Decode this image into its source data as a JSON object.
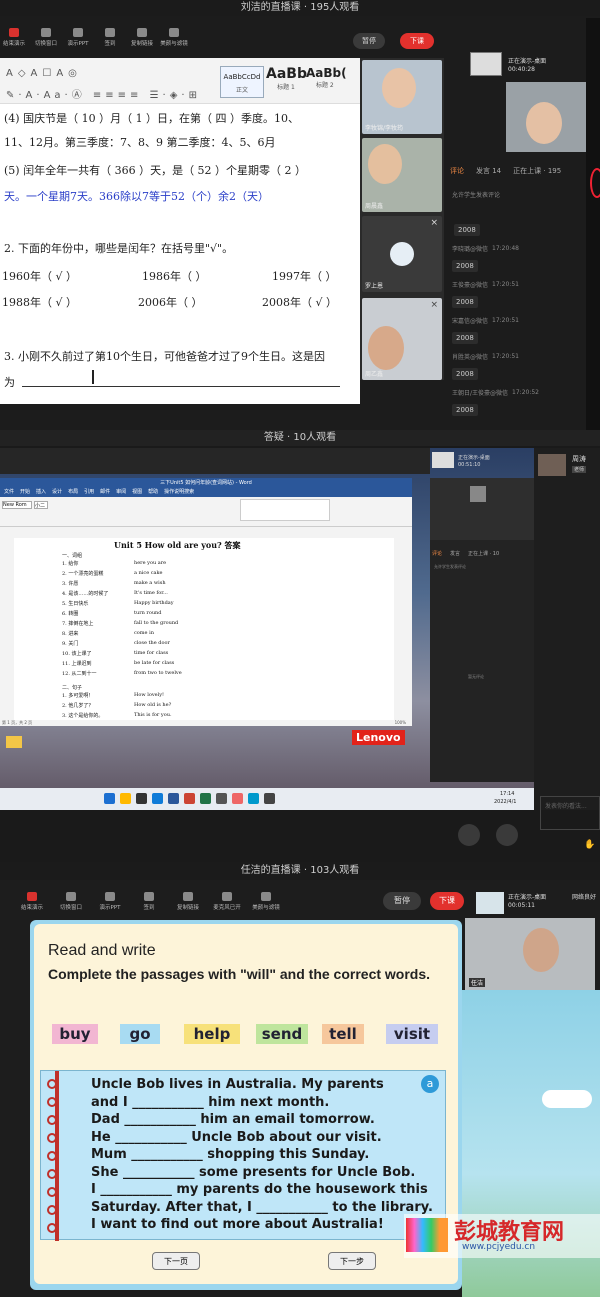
{
  "panel1": {
    "title": "刘洁的直播课 · 195人观看",
    "toolbar": [
      "结束演示",
      "切换窗口",
      "演示PPT",
      "签到",
      "复制链接",
      "美颜与滤镜"
    ],
    "pause": "暂停",
    "end": "下课",
    "ribbon": {
      "styles": [
        "AaBbCcDd",
        "AaBb",
        "AaBb("
      ],
      "style_names": [
        "正文",
        "标题 1",
        "标题 2"
      ]
    },
    "lines": [
      "(4) 国庆节是（  10  ）月（  1 ）日，在第（  四  ）季度。10、",
      "11、12月。第三季度：7、8、9 第二季度：4、5、6月",
      "(5) 闰年全年一共有（  366  ）天，是（  52  ）个星期零（ 2  ）",
      "天。一个星期7天。366除以7等于52（个）余2（天）",
      "2. 下面的年份中，哪些是闰年？在括号里\"√\"。",
      "3. 小刚不久前过了第10个生日，可他爸爸才过了9个生日。这是因",
      "为"
    ],
    "years": [
      [
        "1960年（  √  ）",
        "1986年（    ）",
        "1997年（    ）"
      ],
      [
        "1988年（  √  ）",
        "2006年（    ）",
        "2008年（  √  ）"
      ]
    ],
    "cams": [
      "李牧锦/李牧筠",
      "周晨鑫",
      "罗上恩",
      "周乙鑫"
    ],
    "presenter": {
      "status": "正在演示-桌面",
      "time": "00:40:28"
    },
    "chat_tabs": [
      "评论",
      "发言 14",
      "正在上课 · 195"
    ],
    "allow": "允许学生发表评论",
    "comments": [
      {
        "name": "李晓璐@微信",
        "time": "17:20:48",
        "msg": "2008"
      },
      {
        "name": "王俊豪@微信",
        "time": "17:20:51",
        "msg": "2008"
      },
      {
        "name": "宋嘉信@微信",
        "time": "17:20:51",
        "msg": "2008"
      },
      {
        "name": "肖胜英@微信",
        "time": "17:20:51",
        "msg": "2008"
      },
      {
        "name": "王朝日/王俊豪@微信",
        "time": "17:20:52",
        "msg": "2008"
      }
    ],
    "first_msg": "2008"
  },
  "panel2": {
    "title": "答疑 · 10人观看",
    "word_title": "三下Unit5 如何问年龄(查词网站) - Word",
    "menu": [
      "文件",
      "开始",
      "插入",
      "设计",
      "布局",
      "引用",
      "邮件",
      "审阅",
      "视图",
      "帮助",
      "操作说明搜索"
    ],
    "font": "New Rom",
    "size": "小二",
    "doc_title": "Unit 5 How old are you?  答案",
    "sec1": "一、词组",
    "vocab": [
      [
        "1. 给你",
        "here you are"
      ],
      [
        "2. 一个漂亮的蛋糕",
        "a nice cake"
      ],
      [
        "3. 许愿",
        "make a wish"
      ],
      [
        "4. 是该……的时候了",
        "It's time for..."
      ],
      [
        "5. 生日快乐",
        "Happy birthday"
      ],
      [
        "6. 转圈",
        "turn round"
      ],
      [
        "7. 摔倒在地上",
        "fall to the ground"
      ],
      [
        "8. 进来",
        "come in"
      ],
      [
        "9. 关门",
        "close the door"
      ],
      [
        "10. 该上课了",
        "time for class"
      ],
      [
        "11. 上课迟到",
        "be late for class"
      ],
      [
        "12. 从二到十一",
        "from two to twelve"
      ]
    ],
    "sec2": "二、句子",
    "sents": [
      [
        "1. 多可爱啊！",
        "How lovely!"
      ],
      [
        "2. 他几岁了？",
        "How old is he?"
      ],
      [
        "3. 这个是给你的。",
        "This is for you."
      ]
    ],
    "status": "第 1 页，共 2 页",
    "zoom": "100%",
    "brand": "Lenovo",
    "taskbar_time": "17:14",
    "taskbar_date": "2022/4/1",
    "viewer": "周涛",
    "viewer_badge": "老师",
    "presenter": {
      "status": "正在演示-桌面",
      "time": "00:51:10"
    },
    "chat_tabs": [
      "评论",
      "发言",
      "正在上课 · 10"
    ],
    "allow": "允许学生发表评论",
    "empty": "暂无评论",
    "input_placeholder": "发表你的看法..."
  },
  "panel3": {
    "title": "任洁的直播课 · 103人观看",
    "toolbar": [
      "结束演示",
      "切换窗口",
      "演示PPT",
      "签到",
      "复制链接",
      "麦克风已开",
      "美颜与滤镜"
    ],
    "pause": "暂停",
    "end": "下课",
    "presenter": {
      "status": "正在演示-桌面",
      "time": "00:05:11",
      "net": "网络良好"
    },
    "cam_name": "任洁",
    "heading": "Read and write",
    "instruction": "Complete the passages with \"will\" and the correct words.",
    "words": [
      "buy",
      "go",
      "help",
      "send",
      "tell",
      "visit"
    ],
    "word_colors": [
      "#f2b6d2",
      "#a8dbf2",
      "#f7e17a",
      "#bfe59d",
      "#f6c79c",
      "#c6cdf0"
    ],
    "badge": "a",
    "passage": [
      "Uncle Bob lives in Australia. My parents",
      "and I ___________ him next month.",
      "Dad ___________ him an email tomorrow.",
      "He ___________ Uncle Bob about our visit.",
      "Mum ___________ shopping this Sunday.",
      "She ___________ some presents for Uncle Bob.",
      "I ___________ my parents do the housework this",
      "Saturday. After that, I ___________ to the library.",
      "I want to find out more about Australia!"
    ],
    "btn_prev": "下一页",
    "btn_next": "下一步",
    "watermark": "彭城教育网",
    "watermark_url": "www.pcjyedu.cn"
  }
}
